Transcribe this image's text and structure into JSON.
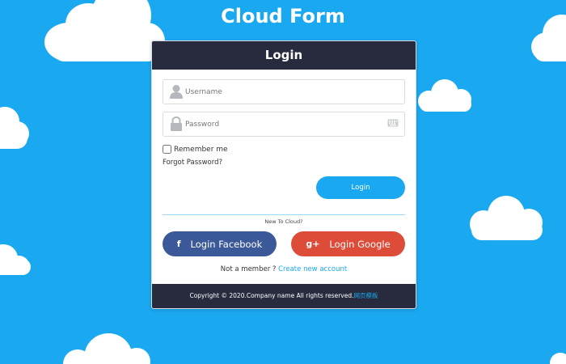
{
  "page": {
    "title": "Cloud Form",
    "background": "#1aa8f0"
  },
  "card": {
    "header": "Login",
    "username": {
      "placeholder": "Username",
      "value": ""
    },
    "password": {
      "placeholder": "Password",
      "value": ""
    },
    "remember_label": "Remember me",
    "forgot_label": "Forgot Password?",
    "login_button": "Login",
    "divider_text": "New To Cloud?",
    "facebook_button": "Login Facebook",
    "facebook_icon": "f",
    "google_button": "Login Google",
    "google_icon": "g+",
    "member_text": "Not a member ?",
    "create_account_link": "Create new account",
    "footer_text": "Copyright © 2020.Company name All rights reserved.",
    "footer_link": "网页模板"
  },
  "colors": {
    "accent": "#1aa8f0",
    "header": "#272b3d",
    "facebook": "#3b5998",
    "google": "#dd4b39"
  },
  "icons": [
    "cloud-icon",
    "user-icon",
    "lock-icon",
    "keyboard-icon",
    "facebook-icon",
    "google-plus-icon"
  ]
}
